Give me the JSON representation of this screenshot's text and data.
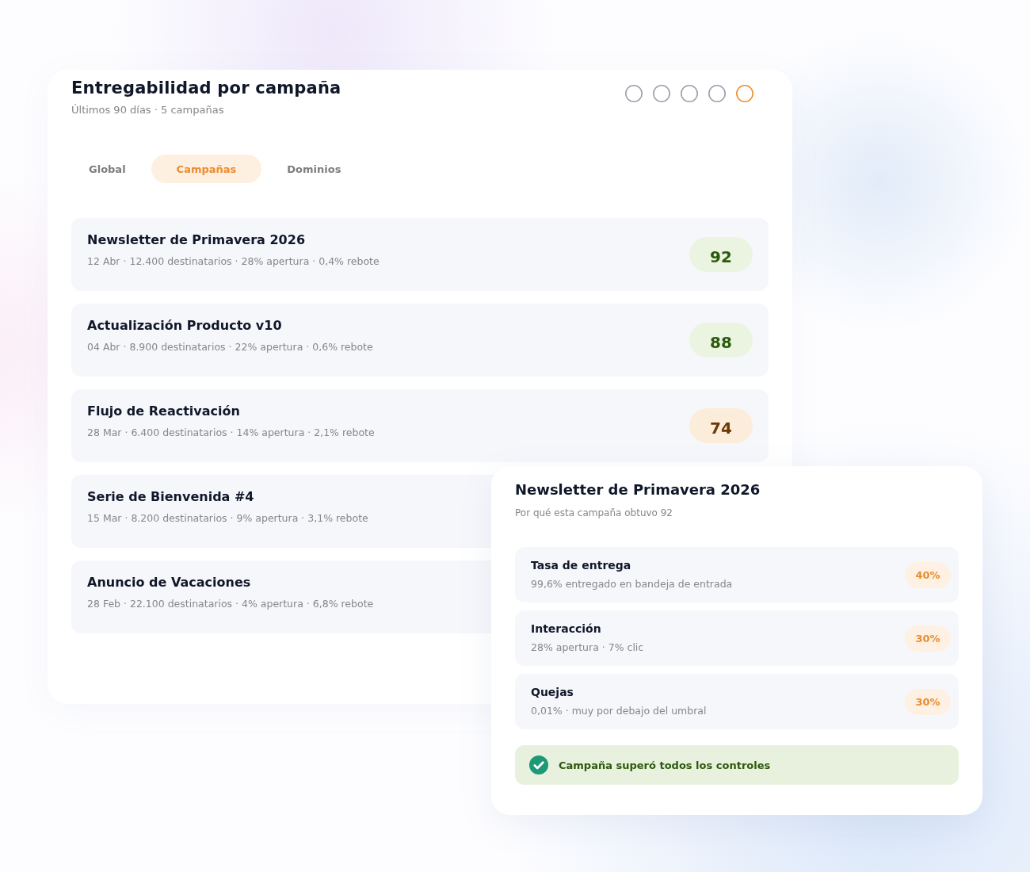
{
  "header": {
    "title": "Entregabilidad por campaña",
    "subtitle": "Últimos 90 días · 5 campañas",
    "pager": [
      {
        "selected": false
      },
      {
        "selected": false
      },
      {
        "selected": false
      },
      {
        "selected": false
      },
      {
        "selected": true
      }
    ]
  },
  "tabs": [
    {
      "label": "Global",
      "selected": false
    },
    {
      "label": "Campañas",
      "selected": true
    },
    {
      "label": "Dominios",
      "selected": false
    }
  ],
  "campaigns": [
    {
      "name": "Newsletter de Primavera 2026",
      "stats": "12 Abr · 12.400 destinatarios · 28% apertura · 0,4% rebote",
      "score": "92",
      "color": "#2b5a0c"
    },
    {
      "name": "Actualización Producto v10",
      "stats": "04 Abr · 8.900 destinatarios · 22% apertura · 0,6% rebote",
      "score": "88",
      "color": "#2b5a0c"
    },
    {
      "name": "Flujo de Reactivación",
      "stats": "28 Mar · 6.400 destinatarios · 14% apertura · 2,1% rebote",
      "score": "74",
      "color": "#6a3a06"
    },
    {
      "name": "Serie de Bienvenida #4",
      "stats": "15 Mar · 8.200 destinatarios · 9% apertura · 3,1% rebote"
    },
    {
      "name": "Anuncio de Vacaciones",
      "stats": "28 Feb · 22.100 destinatarios · 4% apertura · 6,8% rebote"
    }
  ],
  "detail": {
    "title": "Newsletter de Primavera 2026",
    "subtitle": "Por qué esta campaña obtuvo 92",
    "factors": [
      {
        "name": "Tasa de entrega",
        "detail": "99,6% entregado en bandeja de entrada",
        "weight": "40%"
      },
      {
        "name": "Interacción",
        "detail": "28% apertura · 7% clic",
        "weight": "30%"
      },
      {
        "name": "Quejas",
        "detail": "0,01% · muy por debajo del umbral",
        "weight": "30%"
      }
    ],
    "result": {
      "passed": true,
      "text": "Campaña superó todos los controles"
    }
  }
}
